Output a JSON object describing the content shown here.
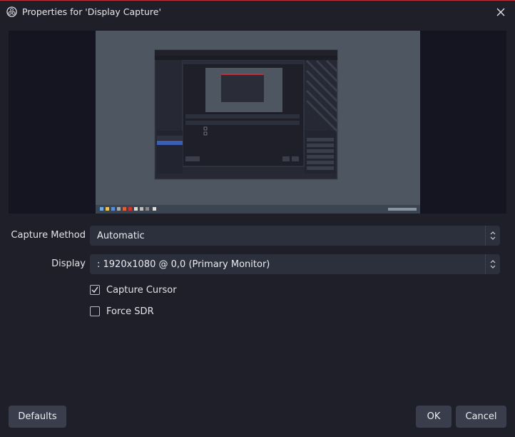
{
  "window": {
    "title": "Properties for 'Display Capture'",
    "accent_color": "#c0303a",
    "background": "#1e1f29",
    "icons": {
      "app": "obs-logo-icon",
      "close": "close-icon"
    }
  },
  "preview": {
    "background": "#4d5661"
  },
  "form": {
    "capture_method": {
      "label": "Capture Method",
      "value": "Automatic"
    },
    "display": {
      "label": "Display",
      "value": ": 1920x1080 @ 0,0 (Primary Monitor)"
    },
    "capture_cursor": {
      "label": "Capture Cursor",
      "checked": true
    },
    "force_sdr": {
      "label": "Force SDR",
      "checked": false
    }
  },
  "buttons": {
    "defaults": "Defaults",
    "ok": "OK",
    "cancel": "Cancel"
  }
}
